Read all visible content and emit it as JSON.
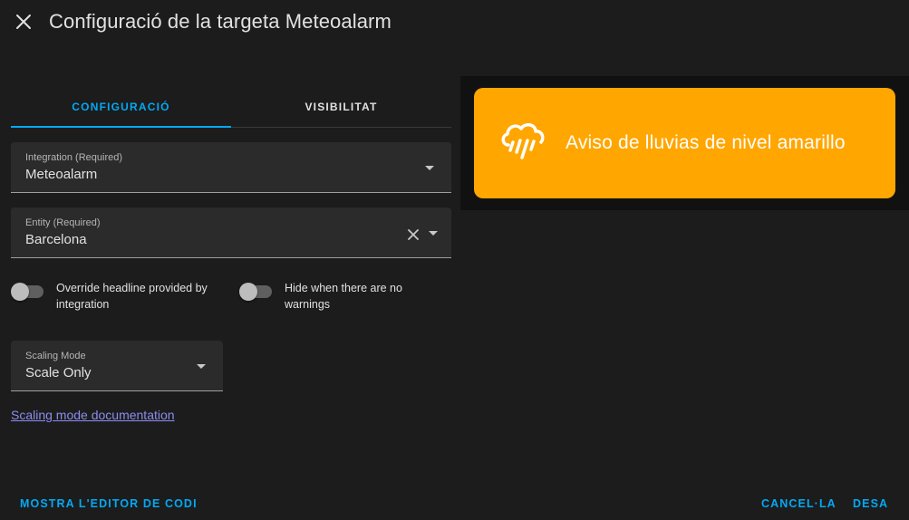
{
  "dialog": {
    "title": "Configuració de la targeta Meteoalarm",
    "close_icon": "close-icon"
  },
  "tabs": [
    {
      "label": "CONFIGURACIÓ",
      "active": true
    },
    {
      "label": "VISIBILITAT",
      "active": false
    }
  ],
  "fields": {
    "integration": {
      "label": "Integration (Required)",
      "value": "Meteoalarm"
    },
    "entity": {
      "label": "Entity (Required)",
      "value": "Barcelona"
    },
    "scaling_mode": {
      "label": "Scaling Mode",
      "value": "Scale Only"
    }
  },
  "switches": {
    "override_headline": {
      "label": "Override headline provided by integration",
      "checked": false
    },
    "hide_no_warnings": {
      "label": "Hide when there are no warnings",
      "checked": false
    }
  },
  "links": {
    "scaling_docs": "Scaling mode documentation"
  },
  "preview": {
    "warning_text": "Aviso de lluvias de nivel amarillo",
    "icon": "weather-pouring-icon",
    "card_color": "#ffa600"
  },
  "footer": {
    "code_editor": "MOSTRA L'EDITOR DE CODI",
    "cancel": "CANCEL·LA",
    "save": "DESA"
  },
  "colors": {
    "accent": "#03a9f4",
    "background": "#1c1c1c",
    "link": "#8c8cf0"
  }
}
